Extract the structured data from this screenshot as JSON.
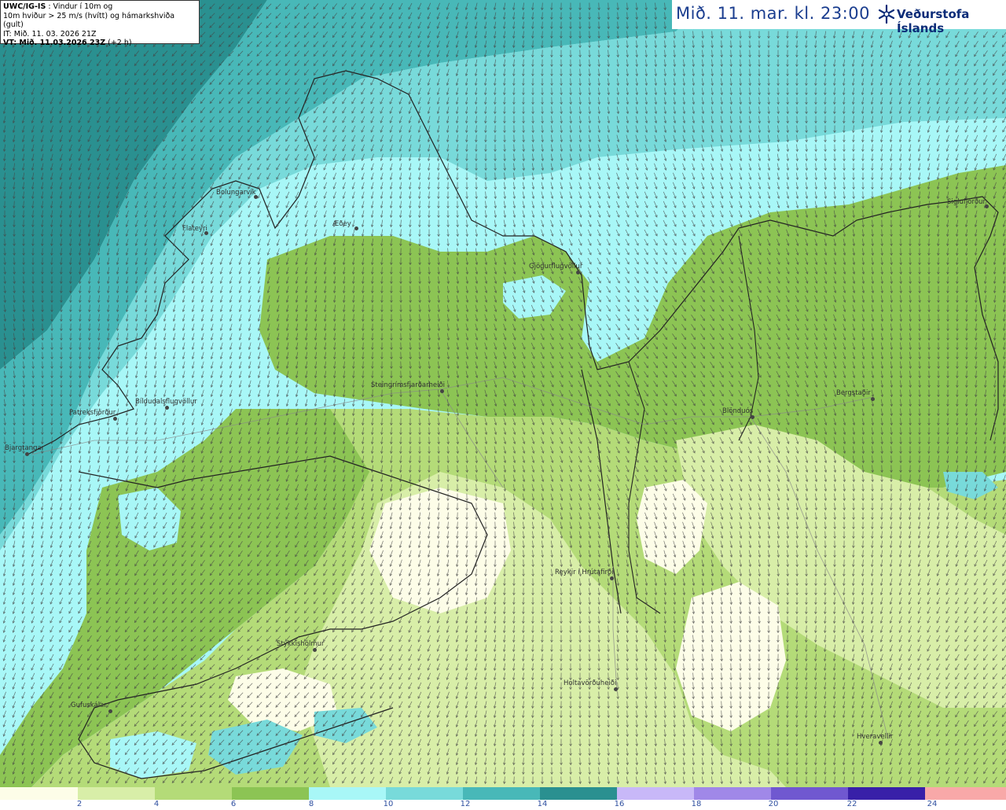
{
  "info": {
    "model_label": "UWC/IG-IS",
    "line1_rest": " : Vindur í 10m og",
    "line2": "10m hviður > 25 m/s (hvítt) og hámarkshviða (gult)",
    "line3": "IT: Mið. 11. 03. 2026 21Z",
    "line4_bold": "VT: Mið. 11.03.2026 23Z",
    "line4_rest": " (+2 h)"
  },
  "valid_time": "Mið. 11. mar. kl. 23:00",
  "brand": {
    "name": "Veðurstofa Íslands",
    "color": "#0c2c78",
    "icon": "snowflake-logo-icon"
  },
  "legend": {
    "labels": [
      "2",
      "4",
      "6",
      "8",
      "10",
      "12",
      "14",
      "16",
      "18",
      "20",
      "22",
      "24"
    ],
    "colors": [
      "#fdfde8",
      "#d8eea8",
      "#b4db78",
      "#8cc454",
      "#a8f7f7",
      "#78dada",
      "#48b8b8",
      "#2a9090",
      "#c8b8f8",
      "#a088e8",
      "#7058d0",
      "#3820a8",
      "#f8a8a8"
    ]
  },
  "towns": [
    {
      "name": "Bolungarvík"
    },
    {
      "name": "Flateyri"
    },
    {
      "name": "Æðey"
    },
    {
      "name": "Gjögurflugvöllur"
    },
    {
      "name": "Siglufjörður"
    },
    {
      "name": "Steingrímsfjarðarheiði"
    },
    {
      "name": "Patreksfjörður"
    },
    {
      "name": "Bíldudalsflugvöllur"
    },
    {
      "name": "Bjargtangar"
    },
    {
      "name": "Blönduós"
    },
    {
      "name": "Bergstaðir"
    },
    {
      "name": "Reykir í Hrútafirði"
    },
    {
      "name": "Stykkishólmur"
    },
    {
      "name": "Holtavörðuheiði"
    },
    {
      "name": "Gufuskálar"
    },
    {
      "name": "Hveravellir"
    }
  ]
}
